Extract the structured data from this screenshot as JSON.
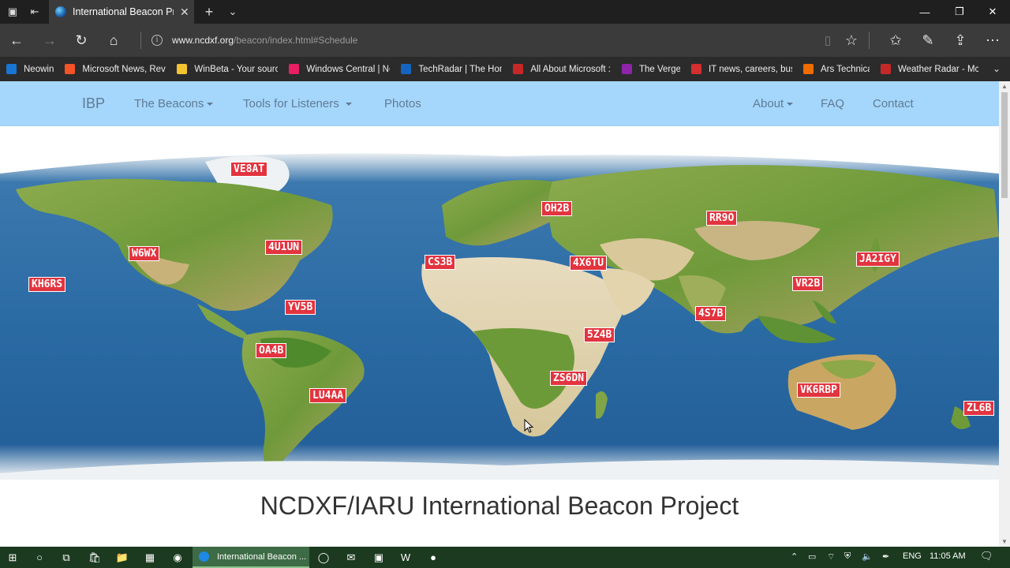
{
  "browser": {
    "tab": {
      "title": "International Beacon Pr"
    },
    "address": {
      "host": "www.ncdxf.org",
      "path": "/beacon/index.html#Schedule"
    },
    "favorites": [
      {
        "label": "Neowin",
        "icon": "neowin-icon",
        "color": "#1976d2"
      },
      {
        "label": "Microsoft News, Revi",
        "icon": "microsoft-icon",
        "color": "#f35325"
      },
      {
        "label": "WinBeta - Your sourc",
        "icon": "winbeta-icon",
        "color": "#f4c430"
      },
      {
        "label": "Windows Central | Ne",
        "icon": "windows-central-icon",
        "color": "#e91e63"
      },
      {
        "label": "TechRadar | The Hom",
        "icon": "techradar-icon",
        "color": "#1565c0"
      },
      {
        "label": "All About Microsoft :",
        "icon": "zdnet-icon",
        "color": "#c62828"
      },
      {
        "label": "The Verge",
        "icon": "verge-icon",
        "color": "#8e24aa"
      },
      {
        "label": "IT news, careers, busi",
        "icon": "cw-icon",
        "color": "#d32f2f"
      },
      {
        "label": "Ars Technica",
        "icon": "ars-icon",
        "color": "#ef6c00"
      },
      {
        "label": "Weather Radar - McG",
        "icon": "weather-icon",
        "color": "#c62828"
      }
    ]
  },
  "site": {
    "brand": "IBP",
    "nav_left": [
      {
        "label": "The Beacons",
        "dropdown": true
      },
      {
        "label": "Tools for Listeners",
        "dropdown": true
      },
      {
        "label": "Photos",
        "dropdown": false
      }
    ],
    "nav_right": [
      {
        "label": "About",
        "dropdown": true
      },
      {
        "label": "FAQ",
        "dropdown": false
      },
      {
        "label": "Contact",
        "dropdown": false
      }
    ],
    "beacons": [
      "VE8AT",
      "OH2B",
      "RR9O",
      "W6WX",
      "4U1UN",
      "CS3B",
      "4X6TU",
      "JA2IGY",
      "KH6RS",
      "VR2B",
      "YV5B",
      "4S7B",
      "5Z4B",
      "OA4B",
      "ZS6DN",
      "VK6RBP",
      "LU4AA",
      "ZL6B"
    ],
    "heading": "NCDXF/IARU International Beacon Project"
  },
  "taskbar": {
    "active_window": "International Beacon ...",
    "language": "ENG",
    "time": "11:05 AM"
  },
  "colors": {
    "nav_bg": "#a5d6fb",
    "beacon_red": "#e2343f",
    "ocean": "#2c6ea6"
  }
}
